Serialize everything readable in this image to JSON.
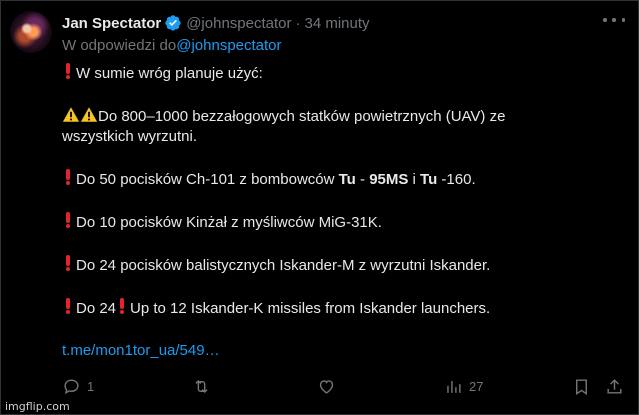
{
  "author": {
    "name": "Jan Spectator",
    "handle": "@johnspectator",
    "time": "34 minuty",
    "verified": true
  },
  "reply": {
    "prefix": "W odpowiedzi do",
    "mention": "@johnspectator"
  },
  "post": {
    "line1": "W sumie wróg planuje użyć:",
    "line2a": "Do 800–1000 bezzałogowych statków powietrznych (UAV) ze",
    "line2b": "wszystkich wyrzutni.",
    "line3_pre": "Do 50 pocisków Ch-101 z bombowców ",
    "line3_tu1": "Tu",
    "line3_dash": " - ",
    "line3_95ms": "95MS",
    "line3_i": " i ",
    "line3_tu2": "Tu",
    "line3_post": " -160.",
    "line4": "Do 10 pocisków Kinżał z myśliwców MiG-31K.",
    "line5": "Do 24 pocisków balistycznych Iskander-M z wyrzutni Iskander.",
    "line6a": "Do 24",
    "line6b": "Up to 12 Iskander-K missiles from Iskander launchers.",
    "link": "t.me/mon1tor_ua/549…"
  },
  "actions": {
    "reply_count": "1",
    "views_count": "27"
  },
  "watermark": "imgflip.com",
  "colors": {
    "background": "#000000",
    "text": "#e7e9ea",
    "muted": "#71767b",
    "link": "#1d9bf0",
    "exclamation": "#e3242b",
    "warning": "#f7c325"
  }
}
